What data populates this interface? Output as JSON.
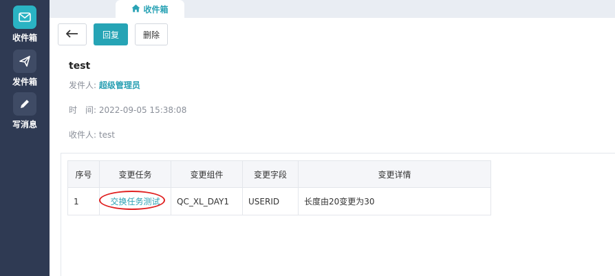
{
  "sidebar": {
    "items": [
      {
        "label": "收件箱",
        "icon": "mail-icon",
        "active": true
      },
      {
        "label": "发件箱",
        "icon": "send-icon",
        "active": false
      },
      {
        "label": "写消息",
        "icon": "pencil-icon",
        "active": false
      }
    ]
  },
  "tabs": [
    {
      "label": "收件箱",
      "icon": "home-icon"
    }
  ],
  "toolbar": {
    "back_icon": "arrow-left-icon",
    "reply_label": "回复",
    "delete_label": "删除"
  },
  "message": {
    "title": "test",
    "sender_label": "发件人:",
    "sender": "超级管理员",
    "time_label": "时　间:",
    "time": "2022-09-05 15:38:08",
    "recipient_label": "收件人:",
    "recipient": "test"
  },
  "table": {
    "headers": [
      "序号",
      "变更任务",
      "变更组件",
      "变更字段",
      "变更详情"
    ],
    "rows": [
      {
        "index": "1",
        "task": "交换任务测试",
        "component": "QC_XL_DAY1",
        "field": "USERID",
        "detail": "长度由20变更为30"
      }
    ]
  },
  "colors": {
    "sidebar_bg": "#2f3a53",
    "accent": "#26a4b5",
    "highlight": "#e02020"
  }
}
